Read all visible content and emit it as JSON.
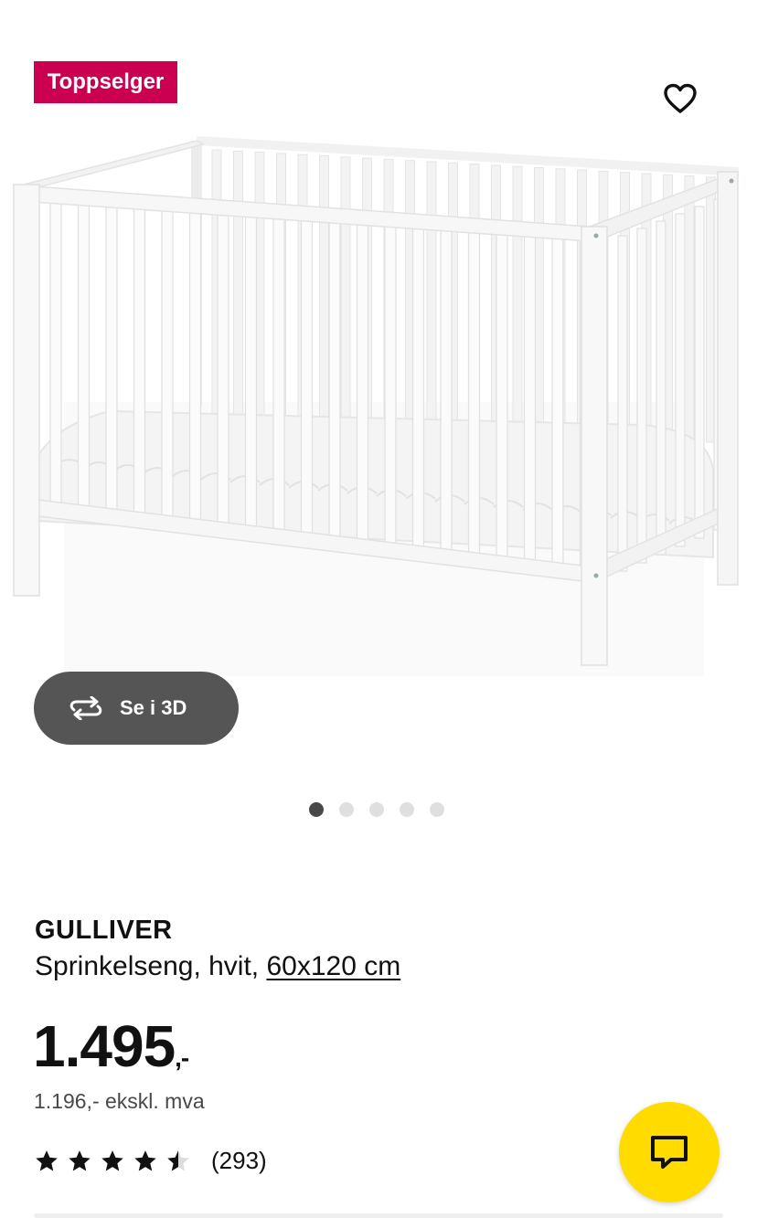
{
  "badge": {
    "label": "Toppselger",
    "color": "#cc0050"
  },
  "favorite": {
    "icon": "heart-outline-icon"
  },
  "image": {
    "subject": "crib-photo"
  },
  "view3d": {
    "label": "Se i 3D",
    "icon": "rotate-3d-icon"
  },
  "carousel": {
    "count": 5,
    "active_index": 0
  },
  "product": {
    "name": "GULLIVER",
    "description_prefix": "Sprinkelseng, hvit, ",
    "size_link": "60x120 cm",
    "price_main": "1.495",
    "price_suffix": ",-",
    "price_excl": "1.196,- ekskl. mva",
    "rating_value": 4.5,
    "rating_max": 5,
    "review_count": "(293)"
  },
  "chat": {
    "icon": "chat-bubble-icon",
    "color": "#ffdb00"
  }
}
